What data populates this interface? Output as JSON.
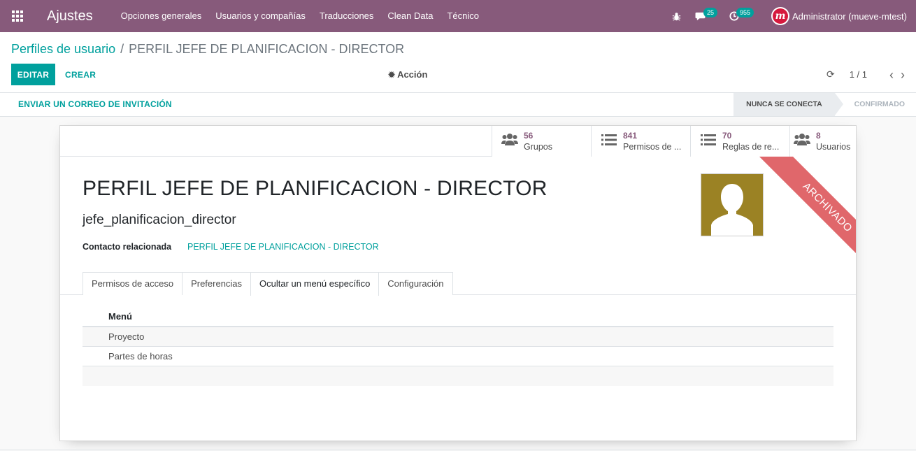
{
  "navbar": {
    "app_title": "Ajustes",
    "menu": [
      "Opciones generales",
      "Usuarios y compañías",
      "Traducciones",
      "Clean Data",
      "Técnico"
    ],
    "messages_count": "25",
    "activities_count": "955",
    "user_name": "Administrator (mueve-mtest)",
    "color": "#875a7b"
  },
  "breadcrumb": {
    "parent": "Perfiles de usuario",
    "separator": "/",
    "current": "PERFIL JEFE DE PLANIFICACION - DIRECTOR"
  },
  "toolbar": {
    "edit_label": "EDITAR",
    "create_label": "CREAR",
    "action_label": "Acción",
    "pager_value": "1 / 1"
  },
  "statusbar": {
    "invite_label": "ENVIAR UN CORREO DE INVITACIÓN",
    "steps": [
      "NUNCA SE CONECTA",
      "CONFIRMADO"
    ],
    "current_step": "NUNCA SE CONECTA"
  },
  "stat_buttons": [
    {
      "value": "56",
      "label": "Grupos",
      "icon": "users-icon"
    },
    {
      "value": "841",
      "label": "Permisos de ...",
      "icon": "list-icon"
    },
    {
      "value": "70",
      "label": "Reglas de re...",
      "icon": "list-icon"
    },
    {
      "value": "8",
      "label": "Usuarios",
      "icon": "users-icon"
    }
  ],
  "ribbon": "ARCHIVADO",
  "record": {
    "name": "PERFIL JEFE DE PLANIFICACION - DIRECTOR",
    "login": "jefe_planificacion_director",
    "contact_label": "Contacto relacionada",
    "contact_value": "PERFIL JEFE DE PLANIFICACION - DIRECTOR"
  },
  "tabs": [
    "Permisos de acceso",
    "Preferencias",
    "Ocultar un menú específico",
    "Configuración"
  ],
  "active_tab": "Ocultar un menú específico",
  "list": {
    "header": "Menú",
    "rows": [
      "Proyecto",
      "Partes de horas"
    ]
  },
  "colors": {
    "accent": "#00a09d",
    "ribbon": "#e0676b",
    "avatar_bg": "#9b8224"
  }
}
